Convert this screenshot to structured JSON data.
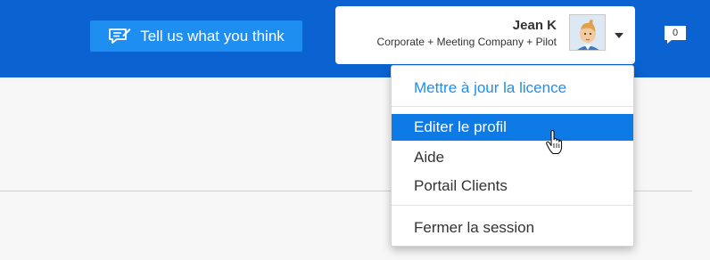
{
  "header": {
    "feedback_label": "Tell us what you think",
    "feedback_icon": "feedback-icon",
    "user_name": "Jean K",
    "user_plan": "Corporate + Meeting Company + Pilot",
    "avatar_icon": "avatar-icon",
    "notification_count": "0"
  },
  "menu": {
    "update_license": "Mettre à jour la licence",
    "edit_profile": "Editer le profil",
    "help": "Aide",
    "client_portal": "Portail Clients",
    "logout": "Fermer la session"
  },
  "colors": {
    "topbar": "#0a63d1",
    "feedback_button": "#1e8ff0",
    "menu_active": "#0e7ae6",
    "link": "#1e8ff0"
  }
}
